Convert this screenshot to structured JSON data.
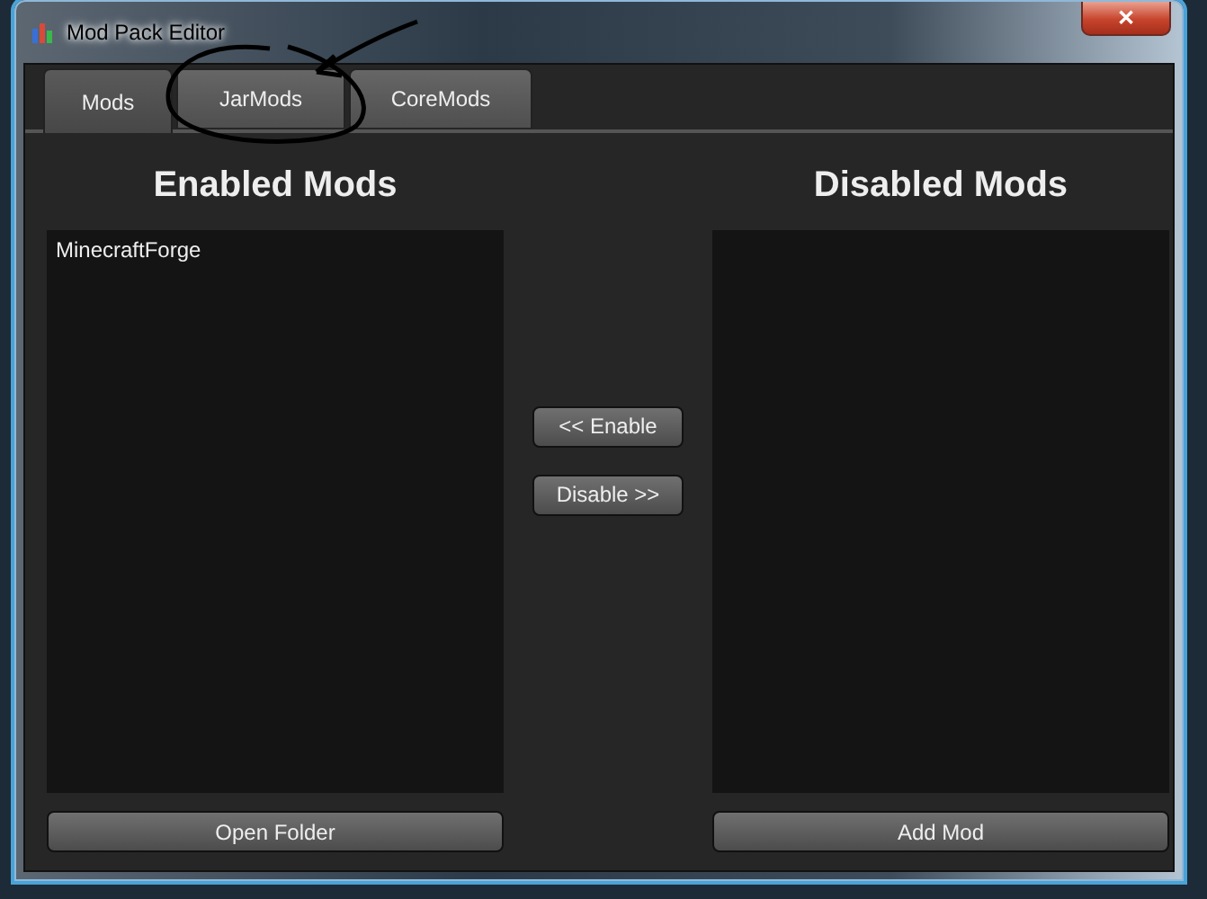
{
  "window": {
    "title": "Mod Pack Editor",
    "close": "✕"
  },
  "tabs": [
    {
      "label": "Mods",
      "selected": true
    },
    {
      "label": "JarMods",
      "selected": false
    },
    {
      "label": "CoreMods",
      "selected": false
    }
  ],
  "enabled": {
    "heading": "Enabled Mods",
    "items": [
      "MinecraftForge"
    ],
    "button": "Open Folder"
  },
  "actions": [
    "<< Enable",
    "Disable >>"
  ],
  "disabled": {
    "heading": "Disabled Mods",
    "button": "Add Mod"
  }
}
